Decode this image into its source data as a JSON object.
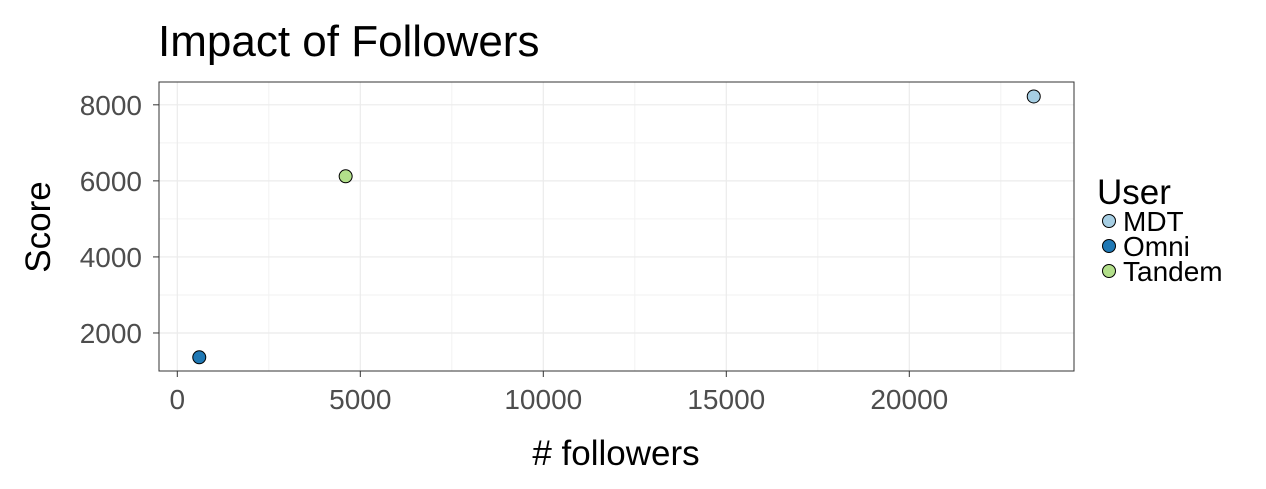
{
  "chart_data": {
    "type": "scatter",
    "title": "Impact of Followers",
    "xlabel": "# followers",
    "ylabel": "Score",
    "xlim": [
      -500,
      24500
    ],
    "ylim": [
      1000,
      8600
    ],
    "x_ticks": [
      0,
      5000,
      10000,
      15000,
      20000
    ],
    "y_ticks": [
      2000,
      4000,
      6000,
      8000
    ],
    "x_tick_labels": [
      "0",
      "5000",
      "10000",
      "15000",
      "20000"
    ],
    "y_tick_labels": [
      "2000",
      "4000",
      "6000",
      "8000"
    ],
    "grid": true,
    "legend_position": "right",
    "legend_title": "User",
    "series": [
      {
        "name": "MDT",
        "color": "#a6cee3",
        "x": [
          23400
        ],
        "y": [
          8220
        ]
      },
      {
        "name": "Omni",
        "color": "#1f78b4",
        "x": [
          600
        ],
        "y": [
          1360
        ]
      },
      {
        "name": "Tandem",
        "color": "#b2df8a",
        "x": [
          4600
        ],
        "y": [
          6120
        ]
      }
    ]
  }
}
